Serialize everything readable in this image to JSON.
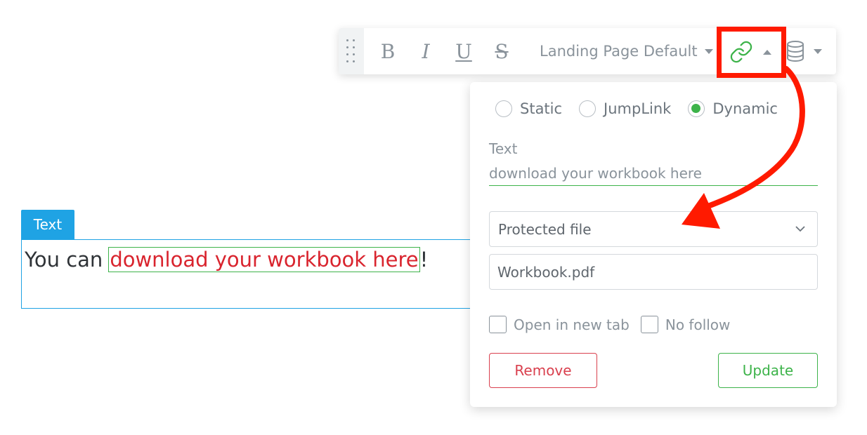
{
  "toolbar": {
    "bold_label": "B",
    "italic_label": "I",
    "underline_label": "U",
    "strike_label": "S",
    "style_selected": "Landing Page Default"
  },
  "element": {
    "tag_label": "Text",
    "text_before": "You can",
    "link_text": "download your workbook here",
    "text_after": "!"
  },
  "link_panel": {
    "link_types": [
      {
        "label": "Static",
        "selected": false
      },
      {
        "label": "JumpLink",
        "selected": false
      },
      {
        "label": "Dynamic",
        "selected": true
      }
    ],
    "text_field_label": "Text",
    "text_field_value": "download your workbook here",
    "source_selected": "Protected file",
    "file_value": "Workbook.pdf",
    "open_new_tab_label": "Open in new tab",
    "no_follow_label": "No follow",
    "remove_label": "Remove",
    "update_label": "Update"
  },
  "colors": {
    "accent_green": "#3db34a",
    "link_red": "#d9242e",
    "tag_blue": "#1fa3e4",
    "annotation_red": "#ff1a00"
  }
}
